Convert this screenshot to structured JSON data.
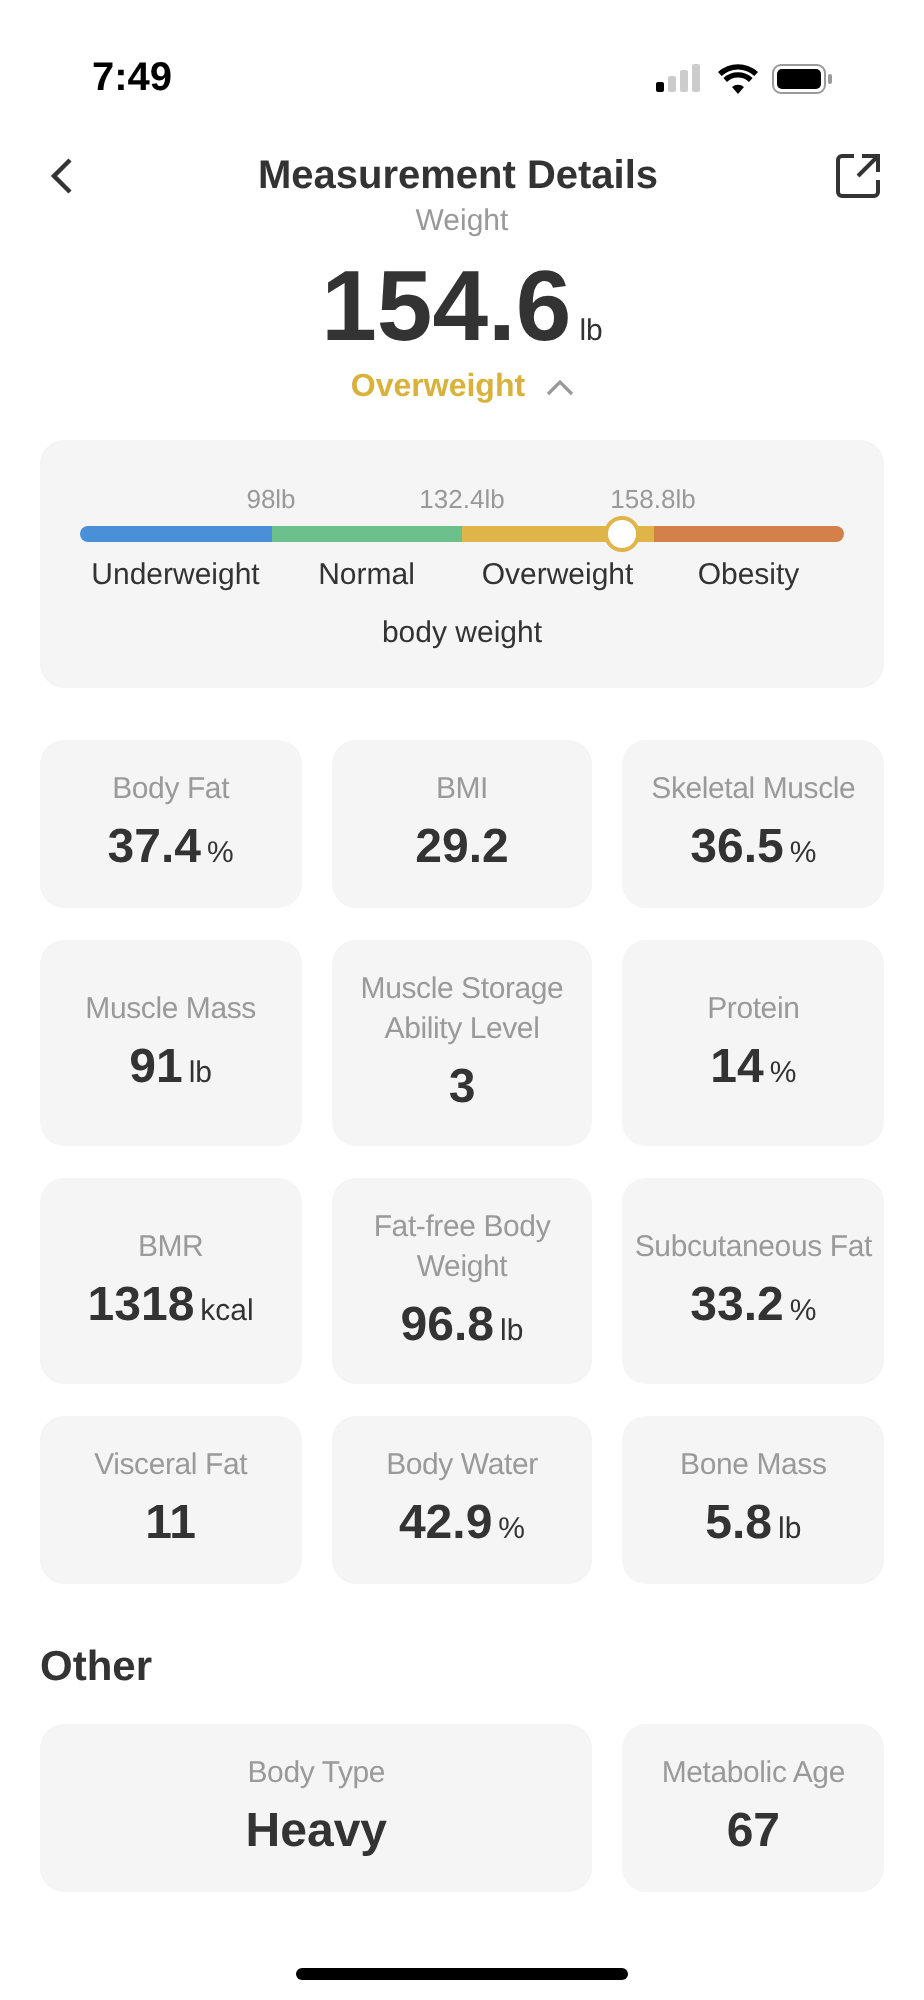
{
  "status_bar": {
    "time": "7:49"
  },
  "header": {
    "title": "Measurement Details"
  },
  "weight": {
    "label": "Weight",
    "value": "154.6",
    "unit": "lb",
    "status": "Overweight",
    "color": "#d9b23c",
    "expanded": true
  },
  "gauge": {
    "level": 0.71,
    "caption": "body weight",
    "thresholds": [
      "98lb",
      "132.4lb",
      "158.8lb"
    ],
    "segments": [
      {
        "label": "Underweight",
        "color": "#4a90d9"
      },
      {
        "label": "Normal",
        "color": "#6cc08b"
      },
      {
        "label": "Overweight",
        "color": "#dfb448"
      },
      {
        "label": "Obesity",
        "color": "#d4804a"
      }
    ]
  },
  "metrics": [
    {
      "label": "Body Fat",
      "value": "37.4",
      "unit": "%"
    },
    {
      "label": "BMI",
      "value": "29.2"
    },
    {
      "label": "Skeletal Muscle",
      "value": "36.5",
      "unit": "%"
    },
    {
      "label": "Muscle Mass",
      "value": "91",
      "unit": "lb"
    },
    {
      "label": "Muscle Storage Ability Level",
      "value": "3"
    },
    {
      "label": "Protein",
      "value": "14",
      "unit": "%"
    },
    {
      "label": "BMR",
      "value": "1318",
      "unit": "kcal"
    },
    {
      "label": "Fat-free Body Weight",
      "value": "96.8",
      "unit": "lb"
    },
    {
      "label": "Subcutaneous Fat",
      "value": "33.2",
      "unit": "%"
    },
    {
      "label": "Visceral Fat",
      "value": "11"
    },
    {
      "label": "Body Water",
      "value": "42.9",
      "unit": "%"
    },
    {
      "label": "Bone Mass",
      "value": "5.8",
      "unit": "lb"
    }
  ],
  "other": {
    "title": "Other",
    "items": [
      {
        "label": "Body Type",
        "value": "Heavy",
        "kind": "wide"
      },
      {
        "label": "Metabolic Age",
        "value": "67",
        "kind": "normal"
      }
    ]
  }
}
